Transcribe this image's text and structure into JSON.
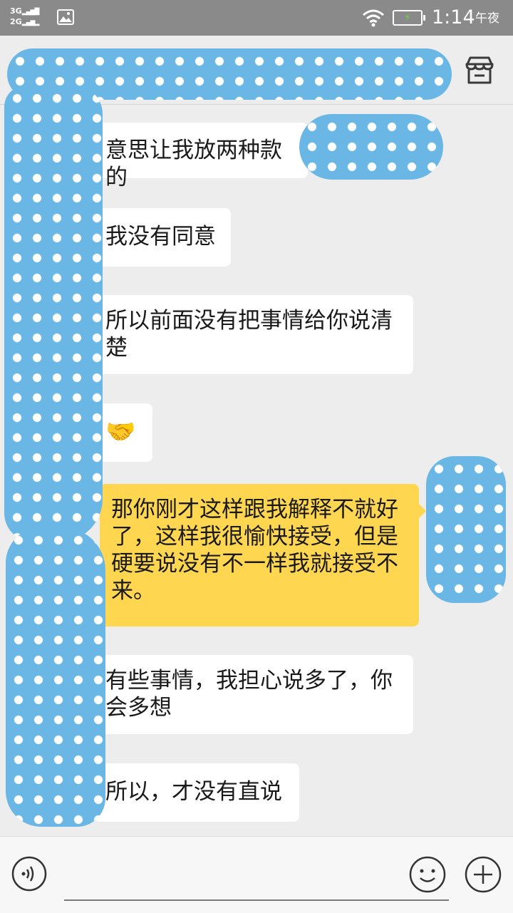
{
  "status_bar": {
    "network_top": "3G",
    "network_bottom": "2G",
    "time": "1:14",
    "period": "午夜"
  },
  "header": {
    "right_icon": "store-icon"
  },
  "messages": [
    {
      "side": "left",
      "text": "意思让我放两种款的"
    },
    {
      "side": "left",
      "text": "我没有同意"
    },
    {
      "side": "left",
      "text": "所以前面没有把事情给你说清楚"
    },
    {
      "side": "left",
      "text": "🤝",
      "emoji": "handshake"
    },
    {
      "side": "right",
      "text": "那你刚才这样跟我解释不就好了，这样我很愉快接受，但是硬要说没有不一样我就接受不来。"
    },
    {
      "side": "left",
      "text": "有些事情，我担心说多了，你会多想"
    },
    {
      "side": "left",
      "text": "所以，才没有直说"
    }
  ],
  "input_bar": {
    "left_icon": "voice-icon",
    "right_icons": [
      "emoji-icon",
      "plus-icon"
    ]
  },
  "colors": {
    "incoming_bubble": "#ffffff",
    "outgoing_bubble": "#ffd650",
    "censor_blue": "#6ab7e6",
    "background": "#ededed"
  }
}
